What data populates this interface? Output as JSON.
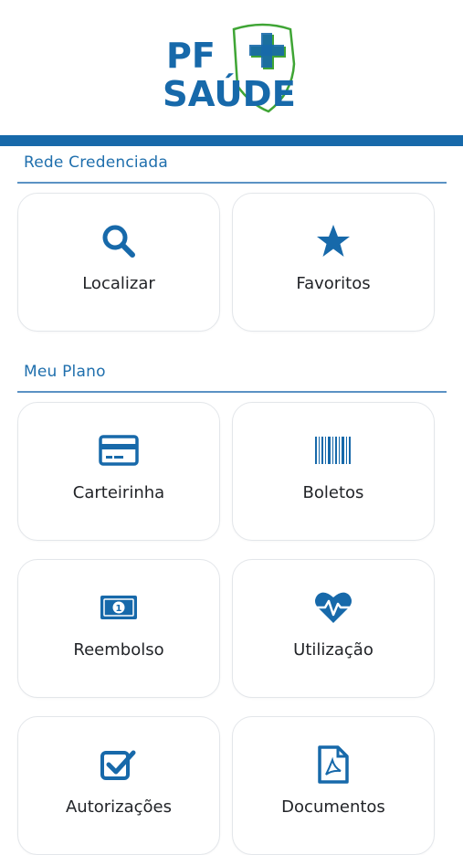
{
  "brand": {
    "line1": "PF",
    "line2": "SAÚDE"
  },
  "colors": {
    "primary": "#1769aa",
    "accent_green": "#3fa535",
    "text": "#222428"
  },
  "sections": {
    "rede": {
      "title": "Rede Credenciada",
      "items": [
        {
          "label": "Localizar",
          "icon": "search-icon"
        },
        {
          "label": "Favoritos",
          "icon": "star-icon"
        }
      ]
    },
    "plano": {
      "title": "Meu Plano",
      "items": [
        {
          "label": "Carteirinha",
          "icon": "credit-card-icon"
        },
        {
          "label": "Boletos",
          "icon": "barcode-icon"
        },
        {
          "label": "Reembolso",
          "icon": "money-bill-icon"
        },
        {
          "label": "Utilização",
          "icon": "heart-pulse-icon"
        },
        {
          "label": "Autorizações",
          "icon": "checkbox-icon"
        },
        {
          "label": "Documentos",
          "icon": "pdf-file-icon"
        }
      ]
    }
  }
}
